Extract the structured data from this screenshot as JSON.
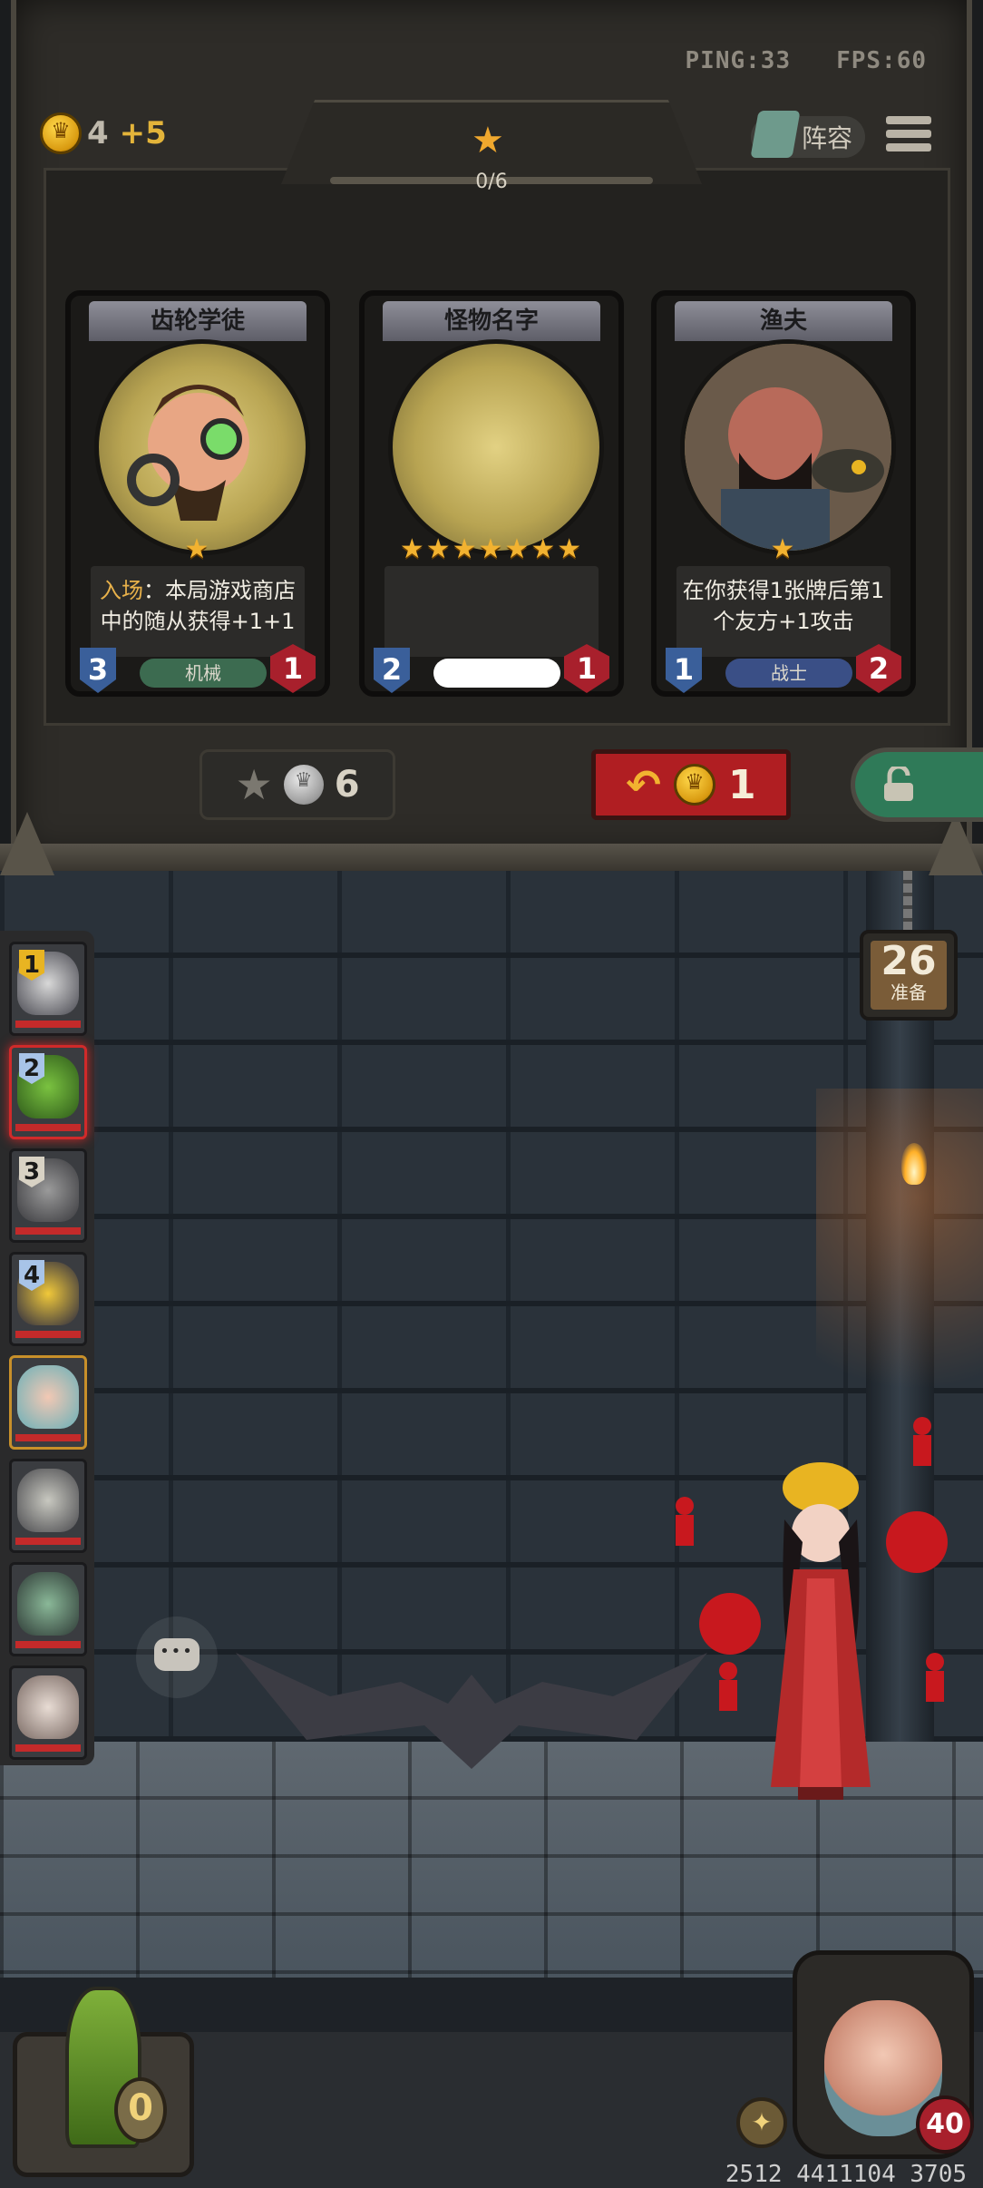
{
  "status": {
    "ping_label": "PING:33",
    "fps_label": "FPS:60"
  },
  "gold": {
    "amount": "4",
    "income": "+5"
  },
  "tier": {
    "progress_text": "0/6"
  },
  "lineup_label": "阵容",
  "cards": [
    {
      "name": "齿轮学徒",
      "stars": "★",
      "desc_keyword": "入场",
      "desc_text": "：本局游戏商店中的随从获得+1+1",
      "cost": "3",
      "attack": "1",
      "tribe": "机械",
      "tribe_color": "#3c6b50"
    },
    {
      "name": "怪物名字",
      "stars": "★★★★★★★",
      "desc_keyword": "",
      "desc_text": "",
      "cost": "2",
      "attack": "1",
      "tribe": "",
      "tribe_color": "#ffffff"
    },
    {
      "name": "渔夫",
      "stars": "★",
      "desc_keyword": "",
      "desc_text": "在你获得1张牌后第1个友方+1攻击",
      "cost": "1",
      "attack": "2",
      "tribe": "战士",
      "tribe_color": "#3a4f86"
    }
  ],
  "upgrade": {
    "cost": "6"
  },
  "refresh": {
    "cost": "1"
  },
  "timer": {
    "value": "26",
    "label": "准备"
  },
  "players": [
    {
      "rank": "1",
      "rank_color": "#e8b422"
    },
    {
      "rank": "2",
      "rank_color": "#a8c4e8"
    },
    {
      "rank": "3",
      "rank_color": "#d8d2c4"
    },
    {
      "rank": "4",
      "rank_color": "#a8c4e8"
    },
    {
      "rank": ""
    },
    {
      "rank": ""
    },
    {
      "rank": ""
    },
    {
      "rank": ""
    }
  ],
  "hud": {
    "resource_count": "0"
  },
  "hero": {
    "health": "40"
  },
  "user_id": "2512 4411104 3705"
}
